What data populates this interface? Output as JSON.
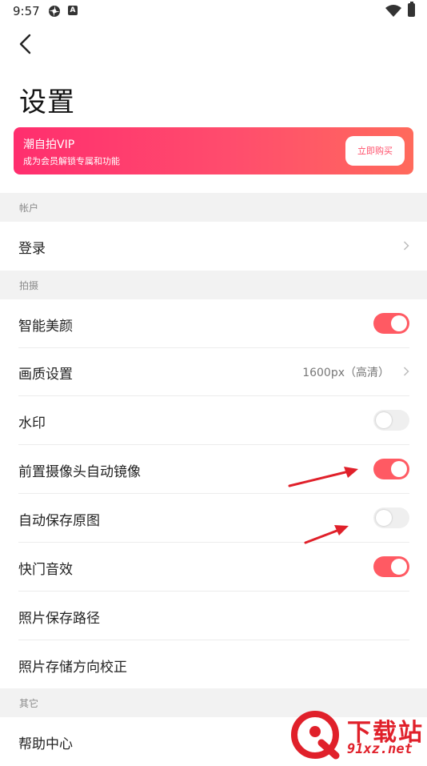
{
  "status_bar": {
    "time": "9:57",
    "b_icon_letter": "A"
  },
  "page": {
    "title": "设置"
  },
  "vip": {
    "title": "潮自拍VIP",
    "subtitle": "成为会员解锁专属和功能",
    "button_label": "立即购买"
  },
  "sections": {
    "account": "帐户",
    "shooting": "拍摄",
    "other": "其它"
  },
  "rows": {
    "login": "登录",
    "smart_beauty": "智能美颜",
    "quality": "画质设置",
    "quality_value": "1600px（高清）",
    "watermark": "水印",
    "front_mirror": "前置摄像头自动镜像",
    "save_original": "自动保存原图",
    "shutter_sound": "快门音效",
    "save_path": "照片保存路径",
    "orientation": "照片存储方向校正",
    "help": "帮助中心"
  },
  "toggles": {
    "smart_beauty": true,
    "watermark": false,
    "front_mirror": true,
    "save_original": false,
    "shutter_sound": true
  },
  "colors": {
    "accent": "#ff5a63",
    "banner_start": "#ff2e6e",
    "banner_end": "#ff6a5c",
    "annotation_arrow": "#e0202a"
  },
  "watermark_overlay": {
    "brand_cn": "下载站",
    "brand_url": "91xz.net"
  }
}
